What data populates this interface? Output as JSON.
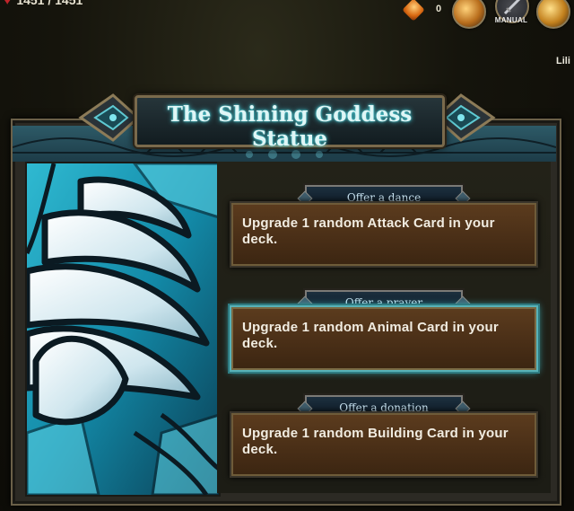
{
  "hud": {
    "hp_text": "1451 / 1451",
    "gem_count": "0",
    "manual_label": "MANUAL",
    "ally_name": "Lili"
  },
  "panel": {
    "title": "The Shining Goddess Statue",
    "options": [
      {
        "tag": "Offer a dance",
        "text": "Upgrade 1 random Attack Card in your deck."
      },
      {
        "tag": "Offer a prayer",
        "text": "Upgrade 1 random Animal Card in your deck."
      },
      {
        "tag": "Offer a donation",
        "text": "Upgrade 1 random Building Card in your deck."
      }
    ]
  },
  "colors": {
    "accent": "#4ad6e0",
    "card_brown": "#4a2f17",
    "panel_frame": "#2d5a67",
    "selected_outline": "#57b2b8"
  }
}
